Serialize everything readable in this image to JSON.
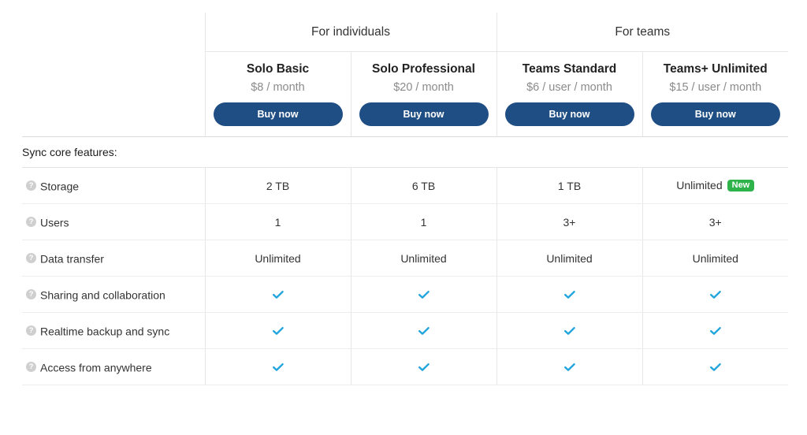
{
  "colors": {
    "button": "#1f4e85",
    "check": "#21a5dd",
    "badge": "#2eb34a",
    "border": "#e7e7e7"
  },
  "groups": [
    {
      "label": "For individuals",
      "span": 2
    },
    {
      "label": "For teams",
      "span": 2
    }
  ],
  "plans": [
    {
      "name": "Solo Basic",
      "price": "$8 / month",
      "cta": "Buy now"
    },
    {
      "name": "Solo Professional",
      "price": "$20 / month",
      "cta": "Buy now"
    },
    {
      "name": "Teams Standard",
      "price": "$6 / user / month",
      "cta": "Buy now"
    },
    {
      "name": "Teams+ Unlimited",
      "price": "$15 / user / month",
      "cta": "Buy now"
    }
  ],
  "section": {
    "title": "Sync core features:"
  },
  "help_icon": "?",
  "features": [
    {
      "label": "Storage",
      "icon": "help-icon",
      "values": [
        {
          "type": "text",
          "text": "2 TB"
        },
        {
          "type": "text",
          "text": "6 TB"
        },
        {
          "type": "text",
          "text": "1 TB"
        },
        {
          "type": "text",
          "text": "Unlimited",
          "badge": "New"
        }
      ]
    },
    {
      "label": "Users",
      "icon": "help-icon",
      "values": [
        {
          "type": "text",
          "text": "1"
        },
        {
          "type": "text",
          "text": "1"
        },
        {
          "type": "text",
          "text": "3+"
        },
        {
          "type": "text",
          "text": "3+"
        }
      ]
    },
    {
      "label": "Data transfer",
      "icon": "help-icon",
      "values": [
        {
          "type": "text",
          "text": "Unlimited"
        },
        {
          "type": "text",
          "text": "Unlimited"
        },
        {
          "type": "text",
          "text": "Unlimited"
        },
        {
          "type": "text",
          "text": "Unlimited"
        }
      ]
    },
    {
      "label": "Sharing and collaboration",
      "icon": "help-icon",
      "values": [
        {
          "type": "check"
        },
        {
          "type": "check"
        },
        {
          "type": "check"
        },
        {
          "type": "check"
        }
      ]
    },
    {
      "label": "Realtime backup and sync",
      "icon": "help-icon",
      "values": [
        {
          "type": "check"
        },
        {
          "type": "check"
        },
        {
          "type": "check"
        },
        {
          "type": "check"
        }
      ]
    },
    {
      "label": "Access from anywhere",
      "icon": "help-icon",
      "values": [
        {
          "type": "check"
        },
        {
          "type": "check"
        },
        {
          "type": "check"
        },
        {
          "type": "check"
        }
      ]
    }
  ]
}
